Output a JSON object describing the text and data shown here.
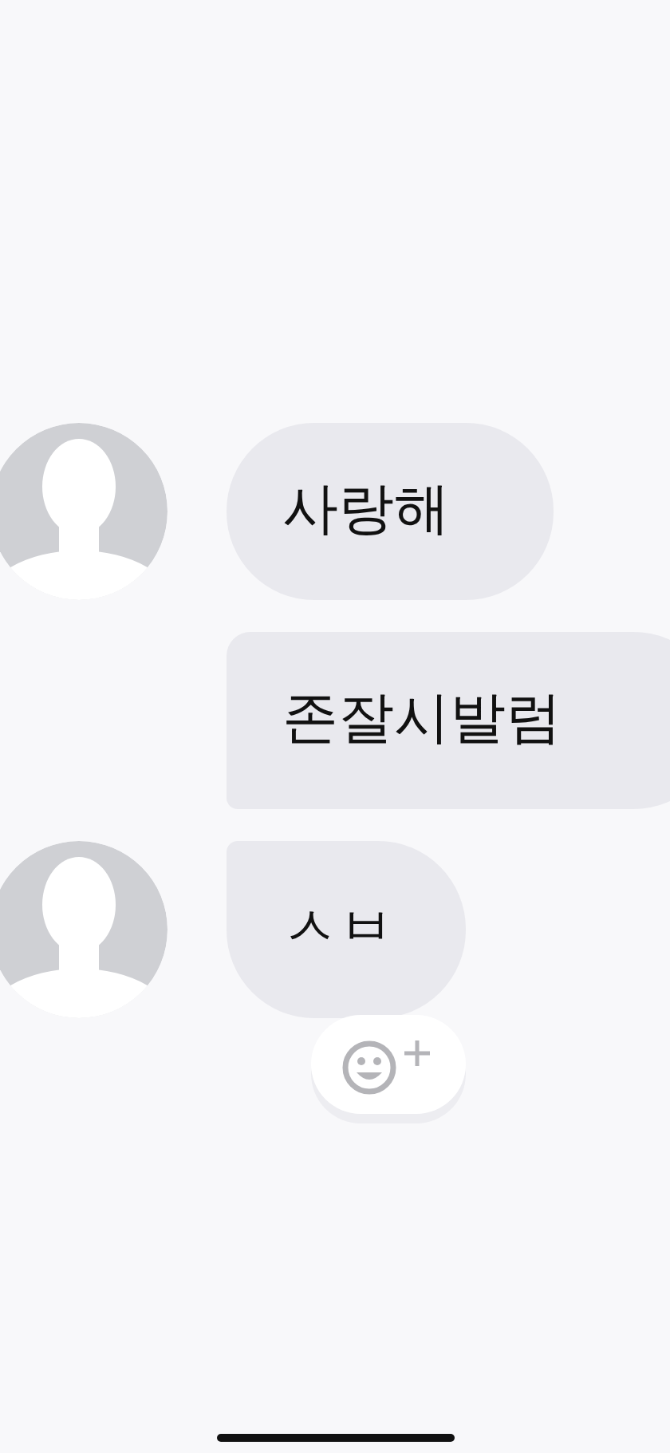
{
  "messages": [
    {
      "text": "사랑해",
      "avatar": true,
      "reaction_button": false
    },
    {
      "text": "존잘시발럼",
      "avatar": false,
      "reaction_button": false
    },
    {
      "text": "ㅅㅂ",
      "avatar": true,
      "reaction_button": true
    }
  ]
}
